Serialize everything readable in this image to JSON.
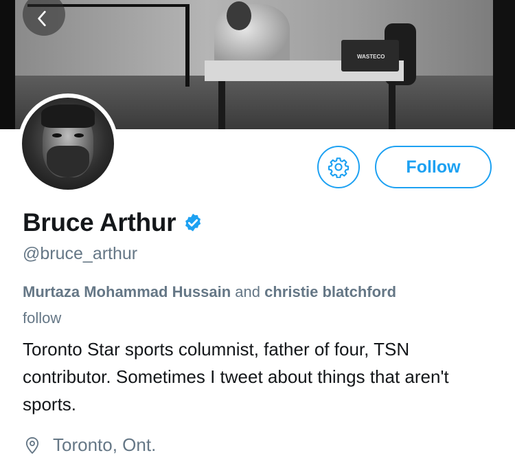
{
  "header": {
    "banner_label_text": "WASTECO",
    "back_icon": "chevron-left-icon"
  },
  "profile": {
    "display_name": "Bruce Arthur",
    "verified_icon": "verified-badge-icon",
    "handle": "@bruce_arthur",
    "followers_you_know": {
      "first": "Murtaza Mohammad Hussain",
      "joiner": " and ",
      "second": "christie blatchford",
      "suffix": "follow"
    },
    "bio": "Toronto Star sports columnist, father of four, TSN contributor. Sometimes I tweet about things that aren't sports.",
    "location": "Toronto, Ont.",
    "location_icon": "location-pin-icon"
  },
  "actions": {
    "settings_icon": "gear-icon",
    "follow_label": "Follow"
  },
  "colors": {
    "accent": "#1da1f2",
    "text_primary": "#14171a",
    "text_secondary": "#657786"
  }
}
